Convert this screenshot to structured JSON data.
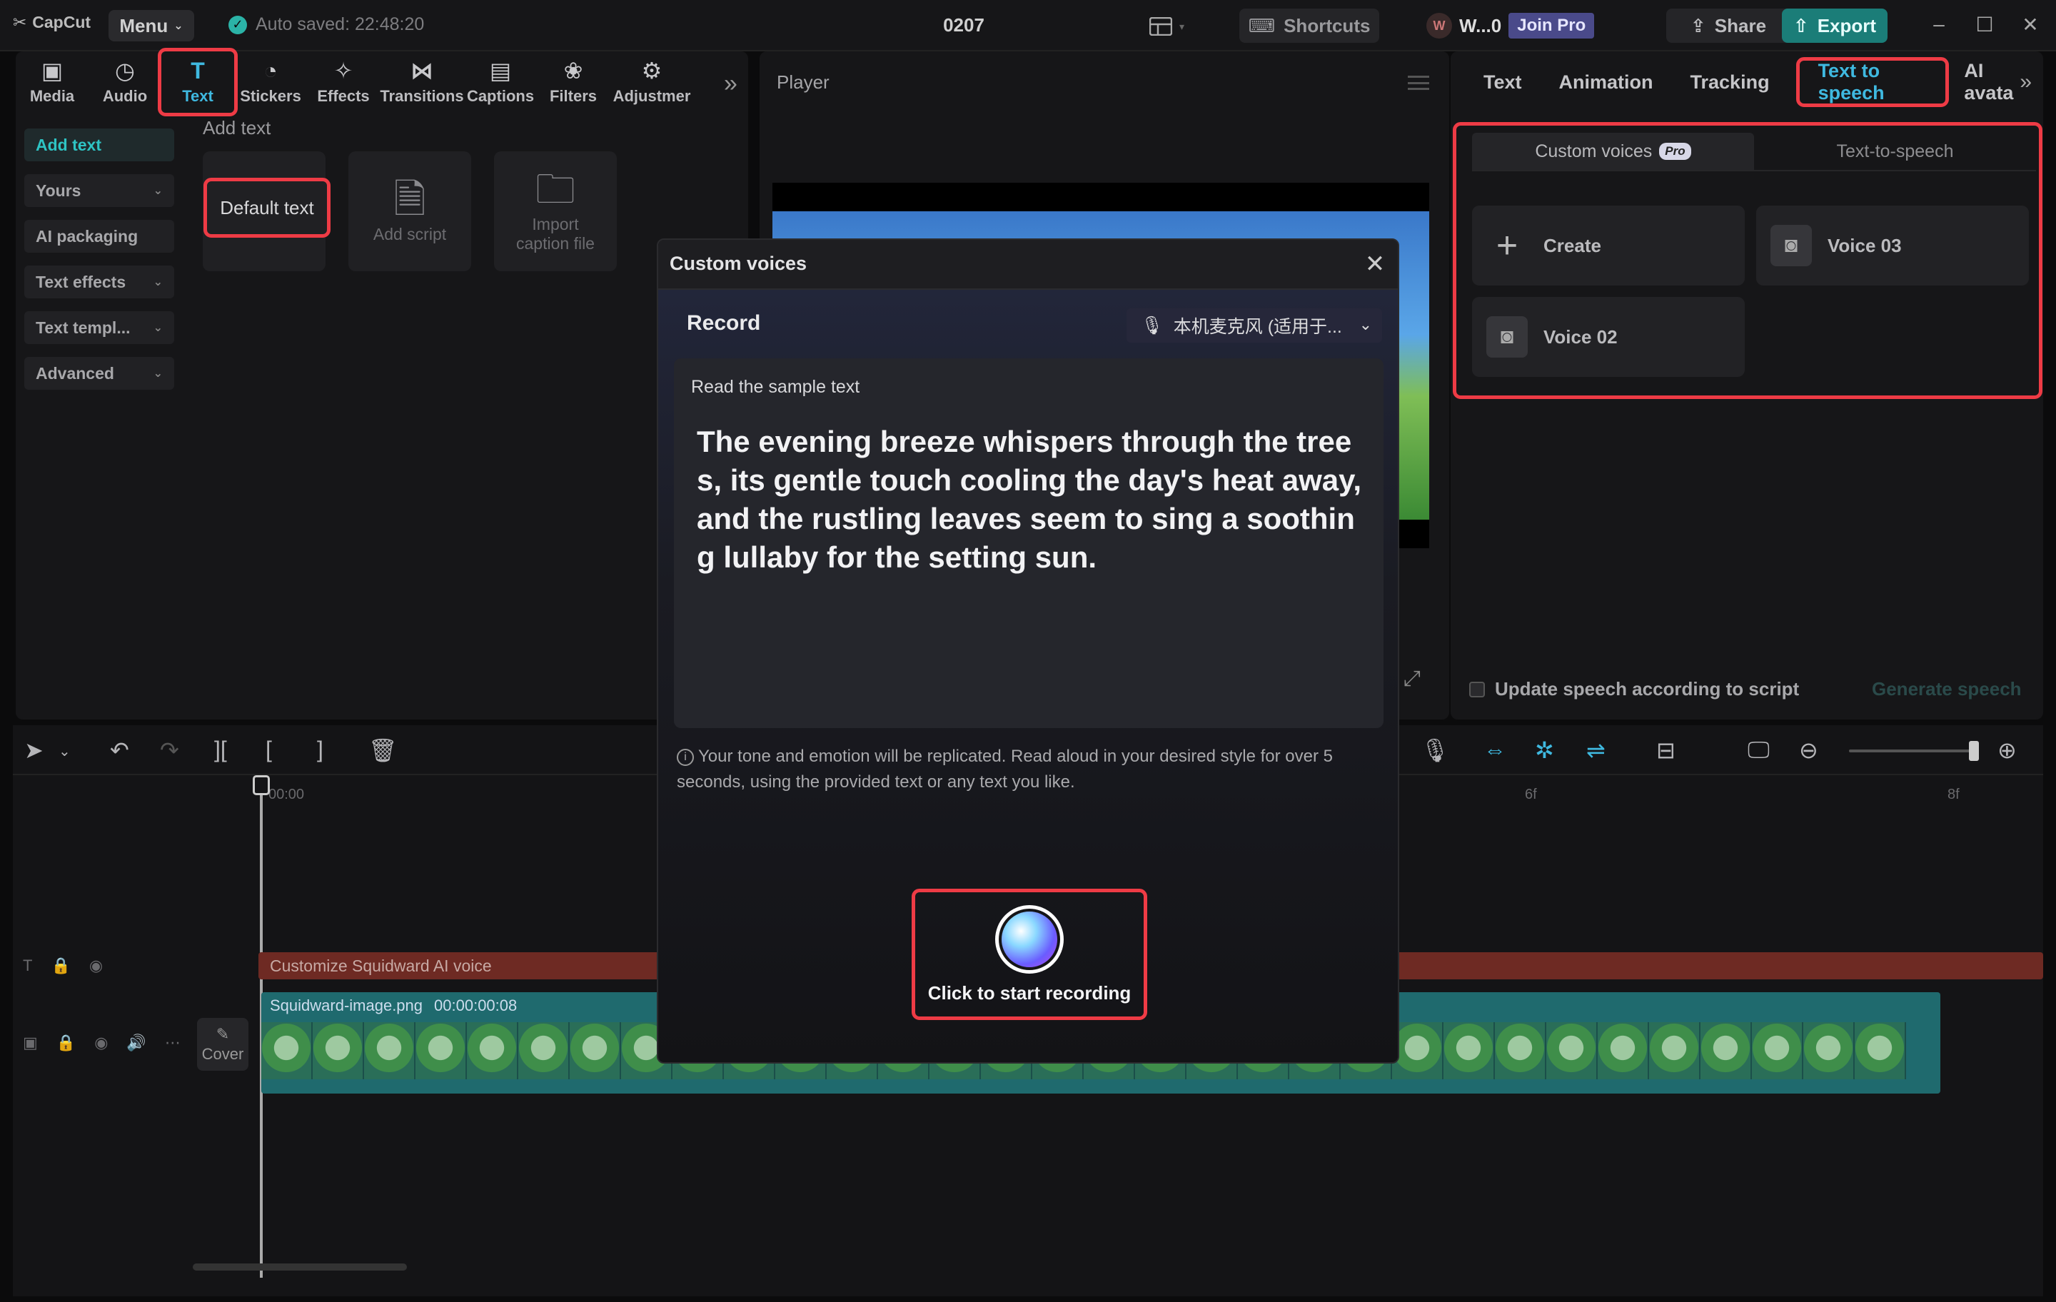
{
  "app": {
    "logo_text": "CapCut",
    "menu_label": "Menu",
    "autosave_text": "Auto saved: 22:48:20",
    "project_name": "0207",
    "shortcuts_label": "Shortcuts",
    "user_initial": "W",
    "user_name": "W...0",
    "join_pro_label": "Join Pro",
    "share_label": "Share",
    "export_label": "Export"
  },
  "tool_tabs": [
    {
      "label": "Media",
      "icon": "media-icon"
    },
    {
      "label": "Audio",
      "icon": "audio-icon"
    },
    {
      "label": "Text",
      "icon": "text-icon"
    },
    {
      "label": "Stickers",
      "icon": "sticker-icon"
    },
    {
      "label": "Effects",
      "icon": "effects-icon"
    },
    {
      "label": "Transitions",
      "icon": "transitions-icon"
    },
    {
      "label": "Captions",
      "icon": "captions-icon"
    },
    {
      "label": "Filters",
      "icon": "filters-icon"
    },
    {
      "label": "Adjustmer",
      "icon": "adjustment-icon"
    }
  ],
  "side_nav": [
    {
      "label": "Add text"
    },
    {
      "label": "Yours"
    },
    {
      "label": "AI packaging"
    },
    {
      "label": "Text effects"
    },
    {
      "label": "Text templ..."
    },
    {
      "label": "Advanced"
    }
  ],
  "add_text": {
    "heading": "Add text",
    "default_text": "Default text",
    "add_script": "Add script",
    "import_caption": "Import caption file"
  },
  "player": {
    "title": "Player"
  },
  "right_panel": {
    "tabs": [
      "Text",
      "Animation",
      "Tracking",
      "Text to speech",
      "AI avata"
    ],
    "subtabs": {
      "custom_voices": "Custom voices",
      "pro_badge": "Pro",
      "tts": "Text-to-speech"
    },
    "voices": {
      "create": "Create",
      "voice_03": "Voice 03",
      "voice_02": "Voice 02"
    },
    "update_label": "Update speech according to script",
    "generate_label": "Generate speech"
  },
  "timeline": {
    "ruler_start": "00:00",
    "ruler_6f": "6f",
    "ruler_8f": "8f",
    "text_clip": "Customize Squidward AI voice",
    "image_clip_name": "Squidward-image.png",
    "image_clip_duration": "00:00:00:08",
    "cover_label": "Cover"
  },
  "modal": {
    "title": "Custom voices",
    "record_title": "Record",
    "mic_label": "本机麦克风 (适用于...",
    "sample_label": "Read the sample text",
    "sample_text": "The evening breeze whispers through the trees, its gentle touch cooling the day's heat away, and the rustling leaves seem to sing a soothing lullaby for the setting sun.",
    "hint": "Your tone and emotion will be replicated. Read aloud in your desired style for over 5 seconds, using the provided text or any text you like.",
    "record_button": "Click to start recording"
  },
  "colors": {
    "accent": "#3fb9e0",
    "highlight": "#ee3b45",
    "export": "#1b7d78",
    "text_clip": "#6e2a23",
    "video_clip": "#1f6a6e"
  }
}
